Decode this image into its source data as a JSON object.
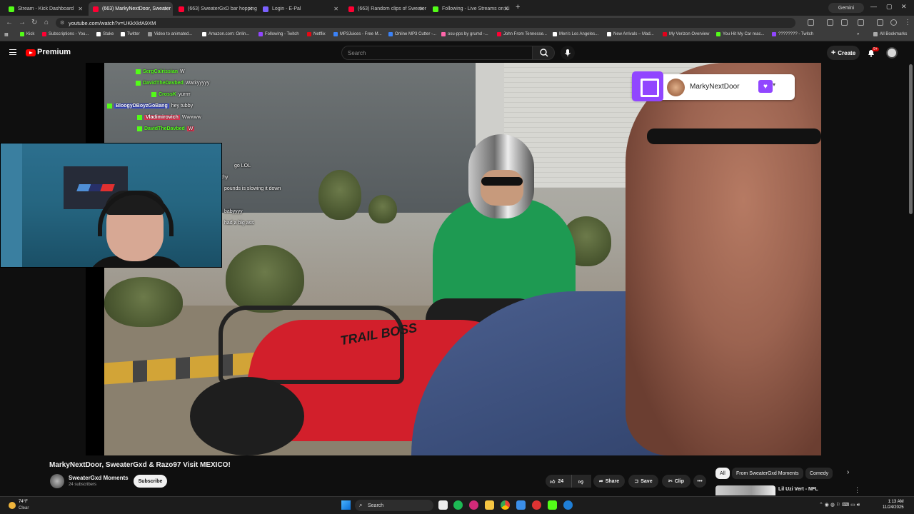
{
  "browser": {
    "tabs": [
      {
        "label": "Stream - Kick Dashboard",
        "color": "#53fc18",
        "active": false
      },
      {
        "label": "(663) MarkyNextDoor, Sweater",
        "color": "#ff0033",
        "active": true
      },
      {
        "label": "(663) SweaterGxD bar hopping",
        "color": "#ff0033",
        "active": false
      },
      {
        "label": "Login - E-Pal",
        "color": "#7b61ff",
        "active": false
      },
      {
        "label": "(663) Random clips of Sweater",
        "color": "#ff0033",
        "active": false
      },
      {
        "label": "Following - Live Streams on Ki",
        "color": "#53fc18",
        "active": false
      }
    ],
    "new_tab": "+",
    "gemini_label": "Gemini",
    "url": "youtube.com/watch?v=UKkXkfA9XM",
    "bookmarks": [
      {
        "label": "Kick",
        "color": "#53fc18"
      },
      {
        "label": "Subscriptions - You...",
        "color": "#ff0033"
      },
      {
        "label": "Stake",
        "color": "#ffffff"
      },
      {
        "label": "Twitter",
        "color": "#ffffff"
      },
      {
        "label": "Video to animated...",
        "color": "#999999"
      },
      {
        "label": "Amazon.com: Onlin...",
        "color": "#ffffff"
      },
      {
        "label": "Following - Twitch",
        "color": "#9146ff"
      },
      {
        "label": "Netflix",
        "color": "#e50914"
      },
      {
        "label": "MP3Juices - Free M...",
        "color": "#3b82f6"
      },
      {
        "label": "Online MP3 Cutter -...",
        "color": "#3b82f6"
      },
      {
        "label": "osu-pps by grumd -...",
        "color": "#ff66aa"
      },
      {
        "label": "John From Tennesse...",
        "color": "#ff0033"
      },
      {
        "label": "Men's Los Angeles...",
        "color": "#ffffff"
      },
      {
        "label": "New Arrivals – Mad...",
        "color": "#ffffff"
      },
      {
        "label": "My Verizon Overview",
        "color": "#e3001b"
      },
      {
        "label": "You Hit My Car reac...",
        "color": "#53fc18"
      },
      {
        "label": "???????? - Twitch",
        "color": "#9146ff"
      }
    ],
    "all_bookmarks": "All Bookmarks"
  },
  "youtube": {
    "brand": "Premium",
    "search_placeholder": "Search",
    "create_label": "Create",
    "notif_count": "9+"
  },
  "overlay": {
    "chat": [
      {
        "user": "SergCalrissian",
        "msg": "W"
      },
      {
        "user": "DavidTheDavbed",
        "msg": "Warkyyyyy"
      },
      {
        "user": "CrossK",
        "msg": "yurrrr"
      },
      {
        "user": "BloogyDBoyzGoBang",
        "msg": "hey tubby"
      },
      {
        "user": "Vladimirovich",
        "msg": "Wwwww"
      },
      {
        "user": "DavidTheDavbed",
        "msg": "W"
      }
    ],
    "chat_partial": [
      "go LOL",
      "thy",
      "pounds is slowing it down",
      "babyyyy",
      "had a big ass"
    ],
    "twitch_name": "MarkyNextDoor",
    "atv_label": "TRAIL BOSS"
  },
  "video": {
    "title": "MarkyNextDoor, SweaterGxd & Razo97 Visit MEXICO!",
    "channel": "SweaterGxd Moments",
    "subscribers": "24 subscribers",
    "subscribe": "Subscribe",
    "likes": "24",
    "share": "Share",
    "save": "Save",
    "clip": "Clip",
    "more": "•••"
  },
  "chips": [
    "All",
    "From SweaterGxd Moments",
    "Comedy"
  ],
  "recommended": {
    "title": "Lil Uzi Vert - NFL"
  },
  "taskbar": {
    "temp": "74°F",
    "weather": "Clear",
    "search": "Search",
    "time": "1:13 AM",
    "date": "11/24/2025"
  }
}
